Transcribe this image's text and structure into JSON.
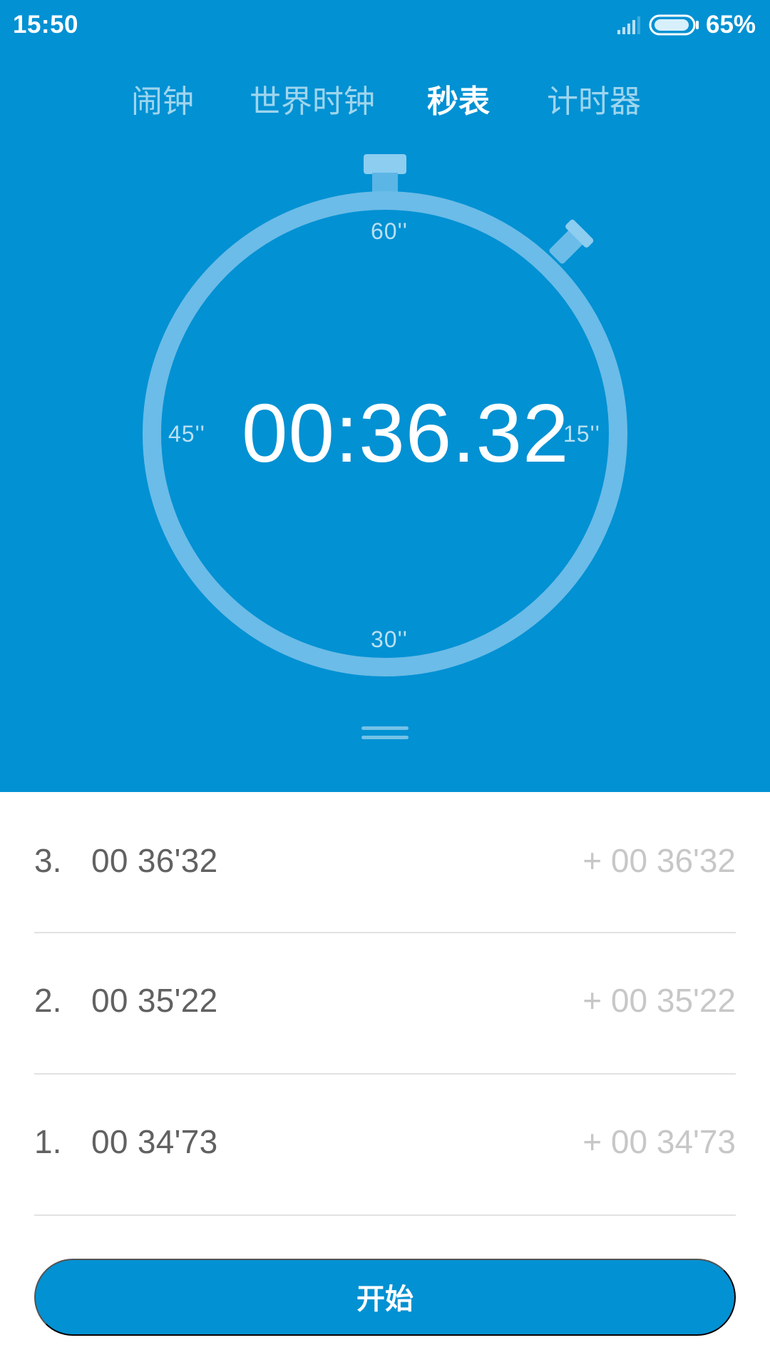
{
  "status_bar": {
    "time": "15:50",
    "battery": "65%",
    "signal_icon": "signal-icon",
    "battery_icon": "battery-icon"
  },
  "tabs": [
    {
      "label": "闹钟",
      "active": false
    },
    {
      "label": "世界时钟",
      "active": false
    },
    {
      "label": "秒表",
      "active": true
    },
    {
      "label": "计时器",
      "active": false
    }
  ],
  "stopwatch": {
    "display": "00:36.32",
    "labels": {
      "top": "60''",
      "right": "15''",
      "bottom": "30''",
      "left": "45''"
    }
  },
  "laps": [
    {
      "index": "3.",
      "time": "00 36'32",
      "diff": "+ 00 36'32"
    },
    {
      "index": "2.",
      "time": "00 35'22",
      "diff": "+ 00 35'22"
    },
    {
      "index": "1.",
      "time": "00 34'73",
      "diff": "+ 00 34'73"
    }
  ],
  "actions": {
    "start_label": "开始"
  },
  "colors": {
    "primary": "#0291d3",
    "ring": "#6bbce8",
    "lap_text": "#616161",
    "lap_diff": "#c7c7c7",
    "divider": "#e2e2e2"
  },
  "icons": {
    "drag_handle": "drag-handle-icon",
    "stopwatch_button_top": "stopwatch-crown-icon",
    "stopwatch_button_side": "stopwatch-side-button-icon"
  }
}
